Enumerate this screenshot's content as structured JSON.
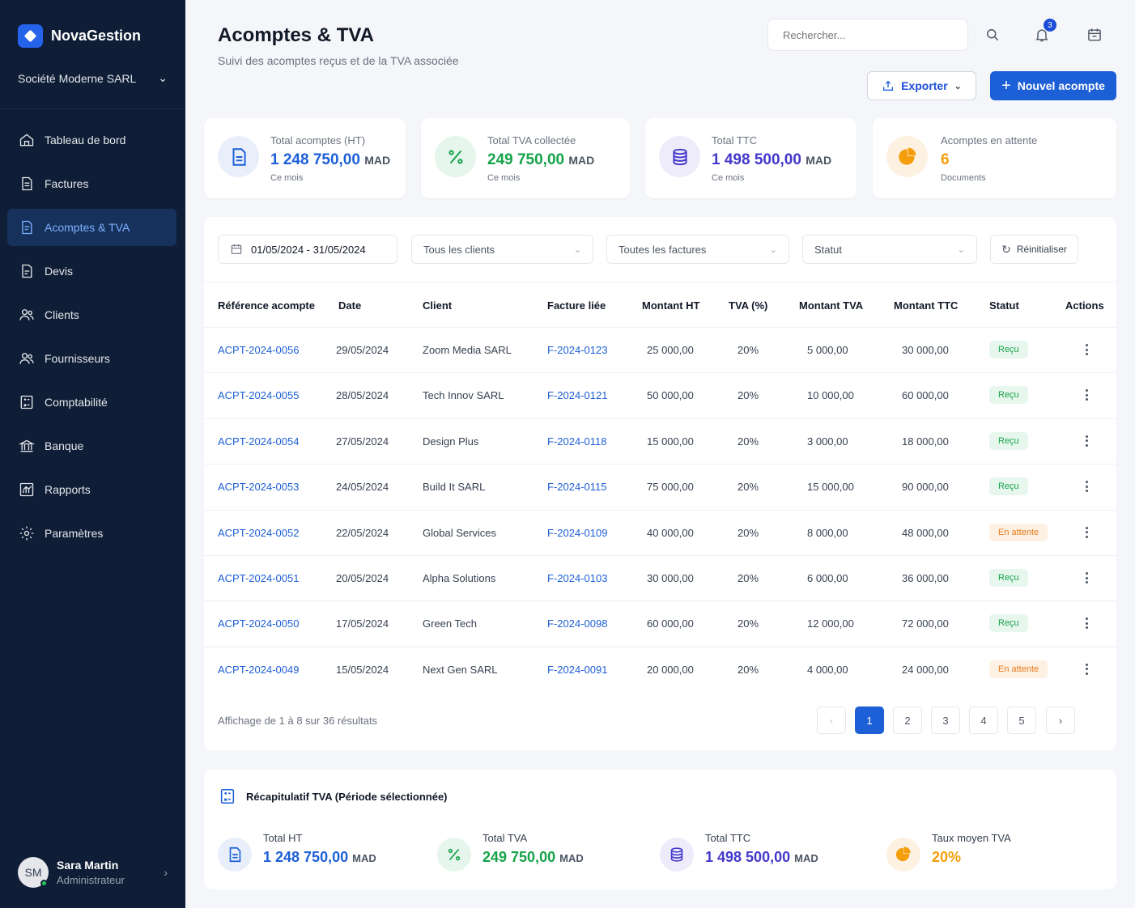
{
  "app": {
    "name": "NovaGestion",
    "company": "Société Moderne SARL"
  },
  "sidebar": {
    "items": [
      {
        "label": "Tableau de bord",
        "icon": "dashboard-icon"
      },
      {
        "label": "Factures",
        "icon": "invoice-icon"
      },
      {
        "label": "Acomptes & TVA",
        "icon": "deposit-icon",
        "active": true
      },
      {
        "label": "Devis",
        "icon": "quote-icon"
      },
      {
        "label": "Clients",
        "icon": "users-icon"
      },
      {
        "label": "Fournisseurs",
        "icon": "suppliers-icon"
      },
      {
        "label": "Comptabilité",
        "icon": "accounting-icon"
      },
      {
        "label": "Banque",
        "icon": "bank-icon"
      },
      {
        "label": "Rapports",
        "icon": "reports-icon"
      },
      {
        "label": "Paramètres",
        "icon": "settings-icon"
      }
    ]
  },
  "user": {
    "initials": "SM",
    "name": "Sara Martin",
    "role": "Administrateur"
  },
  "header": {
    "title": "Acomptes & TVA",
    "subtitle": "Suivi des acomptes reçus et de la TVA associée",
    "search_placeholder": "Rechercher...",
    "notifications_count": "3",
    "export_label": "Exporter",
    "new_label": "Nouvel acompte"
  },
  "stats": [
    {
      "label": "Total acomptes (HT)",
      "value": "1 248 750,00",
      "unit": "MAD",
      "sub": "Ce mois",
      "color": "#1d5fd6",
      "icon": "document-icon"
    },
    {
      "label": "Total TVA collectée",
      "value": "249 750,00",
      "unit": "MAD",
      "sub": "Ce mois",
      "color": "#16a34a",
      "icon": "percent-icon"
    },
    {
      "label": "Total TTC",
      "value": "1 498 500,00",
      "unit": "MAD",
      "sub": "Ce mois",
      "color": "#4338ca",
      "icon": "coins-icon"
    },
    {
      "label": "Acomptes en attente",
      "value": "6",
      "unit": "",
      "sub": "Documents",
      "color": "#f59e0b",
      "icon": "pie-icon"
    }
  ],
  "filters": {
    "date_range": "01/05/2024 - 31/05/2024",
    "client": "Tous les clients",
    "invoice": "Toutes les factures",
    "status": "Statut",
    "reset_label": "Réinitialiser"
  },
  "table": {
    "columns": [
      "Référence acompte",
      "Date",
      "Client",
      "Facture liée",
      "Montant HT",
      "TVA (%)",
      "Montant TVA",
      "Montant TTC",
      "Statut",
      "Actions"
    ],
    "rows": [
      {
        "ref": "ACPT-2024-0056",
        "date": "29/05/2024",
        "client": "Zoom Media SARL",
        "invoice": "F-2024-0123",
        "ht": "25 000,00",
        "tva_rate": "20%",
        "tva": "5 000,00",
        "ttc": "30 000,00",
        "status": "Reçu",
        "status_type": "ok"
      },
      {
        "ref": "ACPT-2024-0055",
        "date": "28/05/2024",
        "client": "Tech Innov SARL",
        "invoice": "F-2024-0121",
        "ht": "50 000,00",
        "tva_rate": "20%",
        "tva": "10 000,00",
        "ttc": "60 000,00",
        "status": "Reçu",
        "status_type": "ok"
      },
      {
        "ref": "ACPT-2024-0054",
        "date": "27/05/2024",
        "client": "Design Plus",
        "invoice": "F-2024-0118",
        "ht": "15 000,00",
        "tva_rate": "20%",
        "tva": "3 000,00",
        "ttc": "18 000,00",
        "status": "Reçu",
        "status_type": "ok"
      },
      {
        "ref": "ACPT-2024-0053",
        "date": "24/05/2024",
        "client": "Build It SARL",
        "invoice": "F-2024-0115",
        "ht": "75 000,00",
        "tva_rate": "20%",
        "tva": "15 000,00",
        "ttc": "90 000,00",
        "status": "Reçu",
        "status_type": "ok"
      },
      {
        "ref": "ACPT-2024-0052",
        "date": "22/05/2024",
        "client": "Global Services",
        "invoice": "F-2024-0109",
        "ht": "40 000,00",
        "tva_rate": "20%",
        "tva": "8 000,00",
        "ttc": "48 000,00",
        "status": "En attente",
        "status_type": "wait"
      },
      {
        "ref": "ACPT-2024-0051",
        "date": "20/05/2024",
        "client": "Alpha Solutions",
        "invoice": "F-2024-0103",
        "ht": "30 000,00",
        "tva_rate": "20%",
        "tva": "6 000,00",
        "ttc": "36 000,00",
        "status": "Reçu",
        "status_type": "ok"
      },
      {
        "ref": "ACPT-2024-0050",
        "date": "17/05/2024",
        "client": "Green Tech",
        "invoice": "F-2024-0098",
        "ht": "60 000,00",
        "tva_rate": "20%",
        "tva": "12 000,00",
        "ttc": "72 000,00",
        "status": "Reçu",
        "status_type": "ok"
      },
      {
        "ref": "ACPT-2024-0049",
        "date": "15/05/2024",
        "client": "Next Gen SARL",
        "invoice": "F-2024-0091",
        "ht": "20 000,00",
        "tva_rate": "20%",
        "tva": "4 000,00",
        "ttc": "24 000,00",
        "status": "En attente",
        "status_type": "wait"
      }
    ]
  },
  "pagination": {
    "info": "Affichage de 1 à 8 sur 36 résultats",
    "pages": [
      "1",
      "2",
      "3",
      "4",
      "5"
    ],
    "current": "1"
  },
  "summary": {
    "title": "Récapitulatif TVA (Période sélectionnée)",
    "items": [
      {
        "label": "Total HT",
        "value": "1 248 750,00",
        "unit": "MAD",
        "color": "#1d5fd6",
        "icon": "document-icon"
      },
      {
        "label": "Total TVA",
        "value": "249 750,00",
        "unit": "MAD",
        "color": "#16a34a",
        "icon": "percent-icon"
      },
      {
        "label": "Total TTC",
        "value": "1 498 500,00",
        "unit": "MAD",
        "color": "#4338ca",
        "icon": "coins-icon"
      },
      {
        "label": "Taux moyen TVA",
        "value": "20%",
        "unit": "",
        "color": "#f59e0b",
        "icon": "pie-icon"
      }
    ]
  }
}
